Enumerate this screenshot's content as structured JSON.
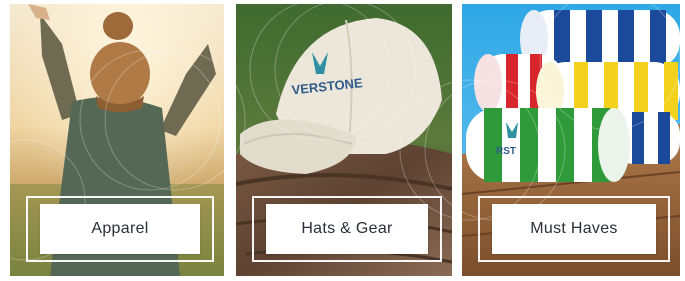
{
  "categories": [
    {
      "label": "Apparel",
      "image_icon": "person-raising-arms-image"
    },
    {
      "label": "Hats & Gear",
      "image_icon": "baseball-cap-image",
      "cap_logo_text": "VERSTONE"
    },
    {
      "label": "Must Haves",
      "image_icon": "rolled-towels-image",
      "towel_logo_text": "RST"
    }
  ],
  "colors": {
    "label_text": "#2b2f38",
    "label_bg": "#ffffff",
    "frame": "#ffffff"
  }
}
